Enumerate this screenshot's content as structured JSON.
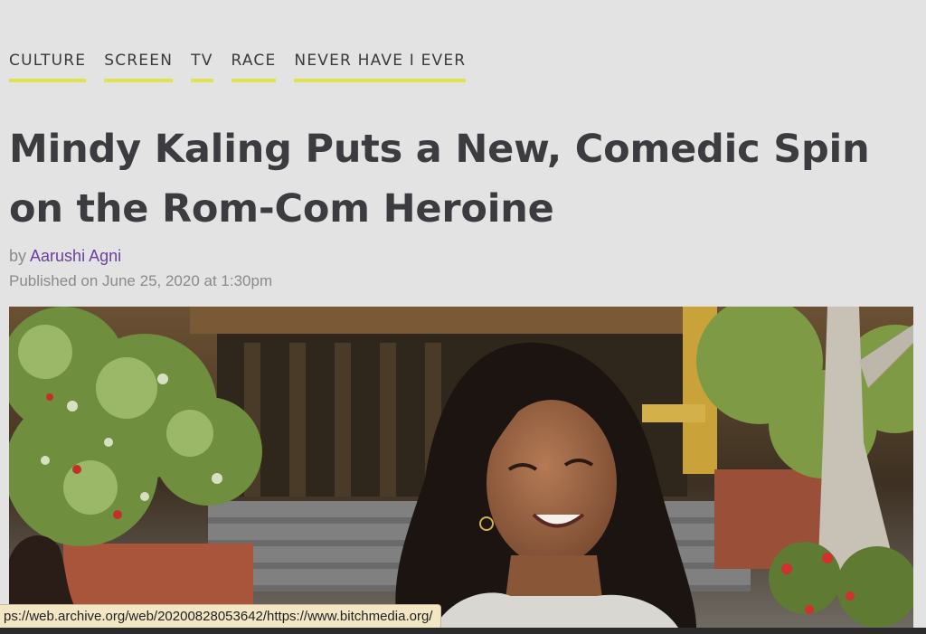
{
  "tags": [
    {
      "label": "CULTURE"
    },
    {
      "label": "SCREEN"
    },
    {
      "label": "TV"
    },
    {
      "label": "RACE"
    },
    {
      "label": "NEVER HAVE I EVER"
    }
  ],
  "article": {
    "title": "Mindy Kaling Puts a New, Comedic Spin on the Rom-Com Heroine",
    "by_prefix": "by",
    "author": "Aarushi Agni",
    "published": "Published on June 25, 2020 at 1:30pm"
  },
  "hero": {
    "subject": "young woman with long dark wavy hair smiling outdoors at a school courtyard"
  },
  "status_bar": {
    "url": "ps://web.archive.org/web/20200828053642/https://www.bitchmedia.org/"
  },
  "colors": {
    "tag_underline": "#e2e24a",
    "author_link": "#6b3fa0",
    "headline": "#3b3b40"
  }
}
